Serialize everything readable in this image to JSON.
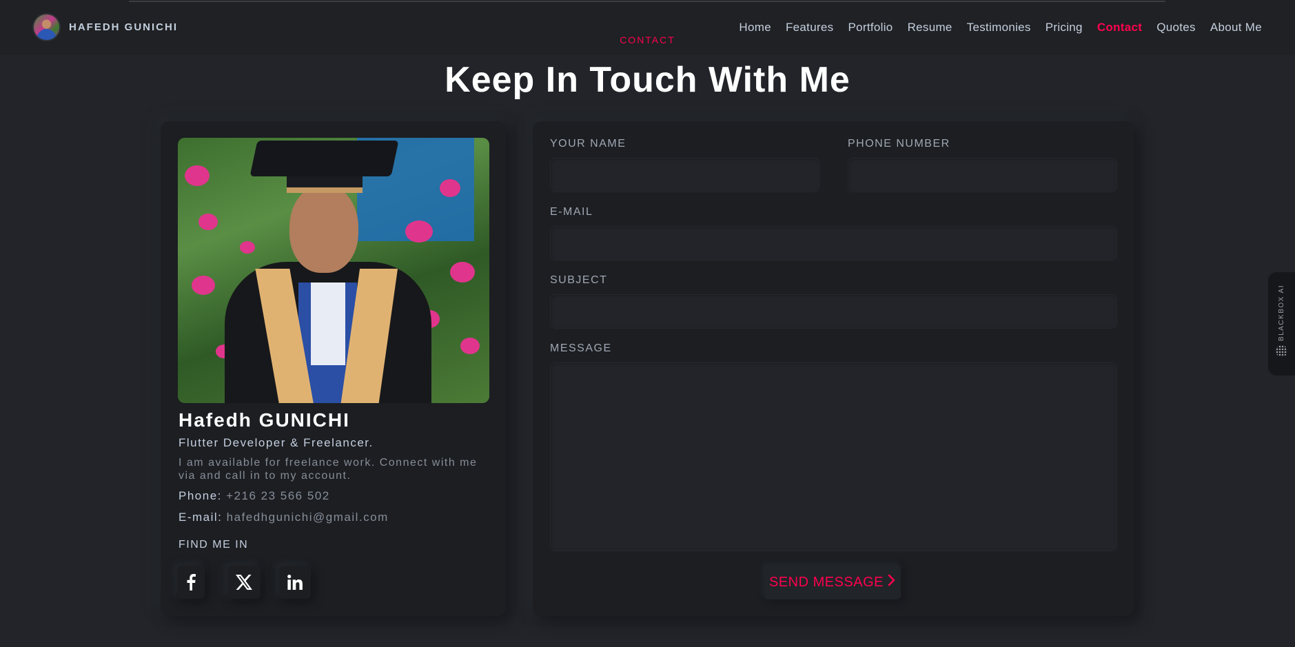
{
  "brand": {
    "name": "HAFEDH GUNICHI"
  },
  "nav": {
    "items": [
      "Home",
      "Features",
      "Portfolio",
      "Resume",
      "Testimonies",
      "Pricing",
      "Contact",
      "Quotes",
      "About Me"
    ],
    "active": "Contact"
  },
  "section": {
    "label": "CONTACT",
    "title": "Keep In Touch With Me"
  },
  "profile": {
    "name": "Hafedh GUNICHI",
    "role": "Flutter Developer & Freelancer.",
    "description": "I am available for freelance work. Connect with me via and call in to my account.",
    "phone_label": "Phone:",
    "phone": "+216 23 566 502",
    "email_label": "E-mail:",
    "email": "hafedhgunichi@gmail.com",
    "find_me": "FIND ME IN",
    "socials": [
      "facebook-icon",
      "x-icon",
      "linkedin-icon"
    ]
  },
  "form": {
    "name_label": "YOUR NAME",
    "name_value": "",
    "phone_label": "PHONE NUMBER",
    "phone_value": "",
    "email_label": "E-MAIL",
    "email_value": "",
    "subject_label": "SUBJECT",
    "subject_value": "",
    "message_label": "MESSAGE",
    "message_value": "",
    "submit_label": "SEND MESSAGE"
  },
  "side_widget": {
    "label": "BLACKBOX AI"
  },
  "colors": {
    "accent": "#ff014f",
    "background": "#222429",
    "card": "#1c1e22",
    "text": "#c4cfde"
  }
}
